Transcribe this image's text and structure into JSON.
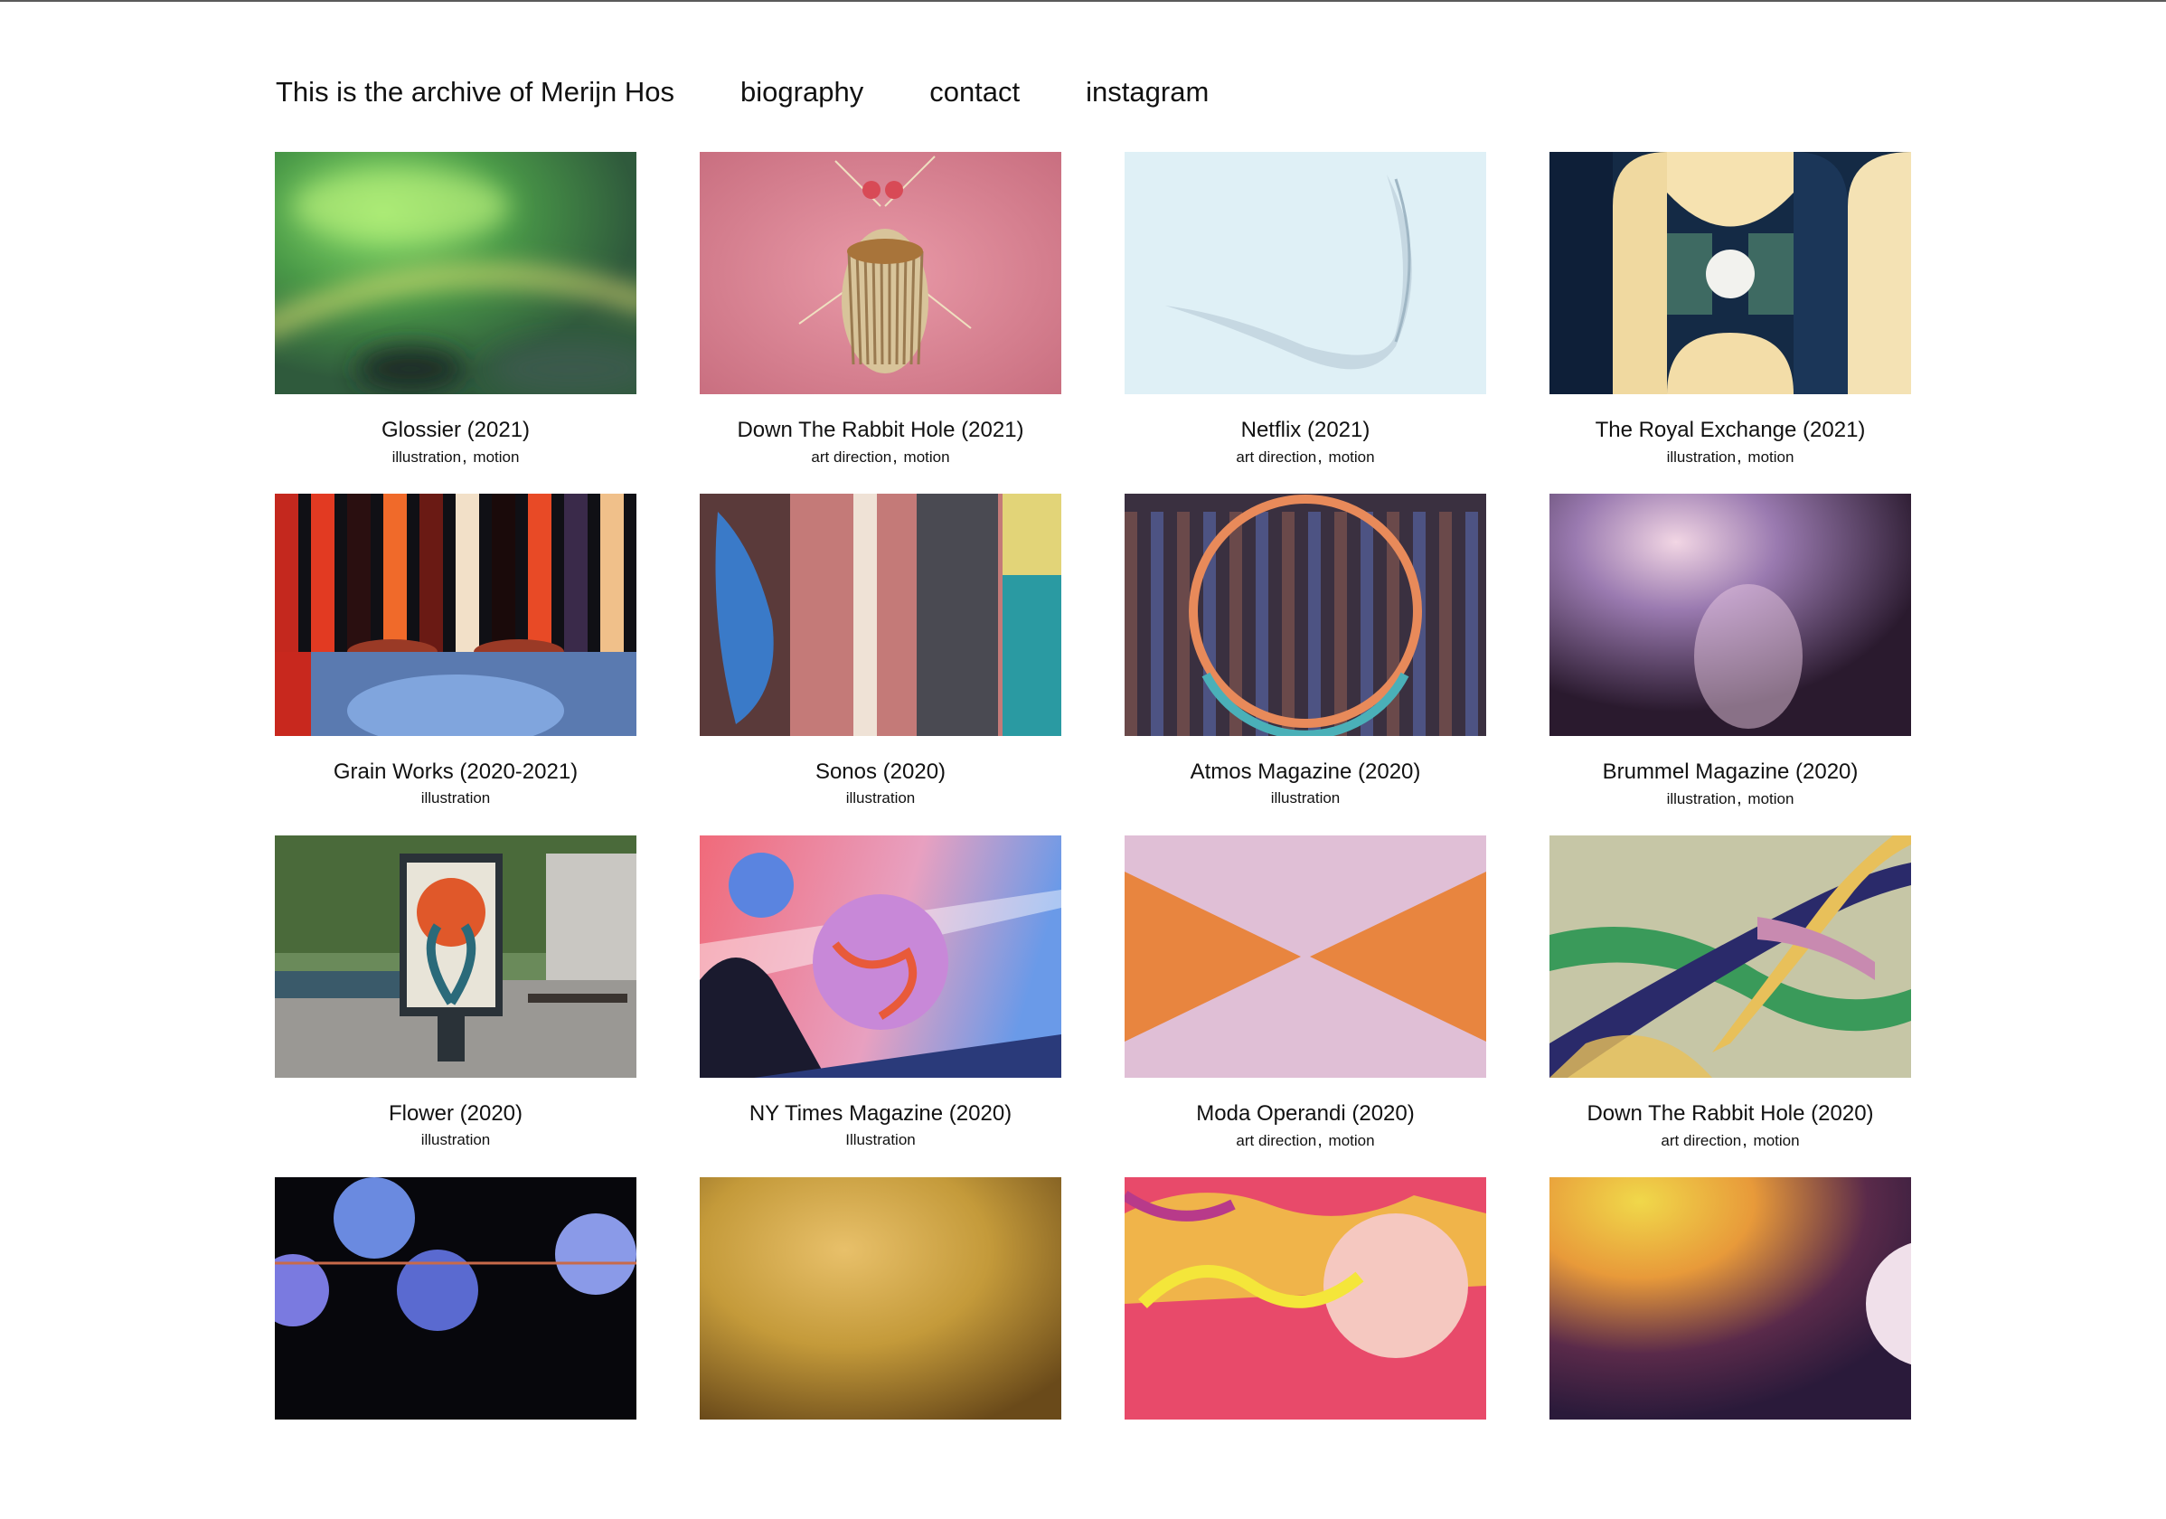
{
  "nav": {
    "site_title": "This is the archive of Merijn Hos",
    "links": [
      "biography",
      "contact",
      "instagram"
    ]
  },
  "projects": [
    {
      "title": "Glossier (2021)",
      "tags": [
        "illustration",
        "motion"
      ],
      "thumb": "glossier"
    },
    {
      "title": "Down The Rabbit Hole (2021)",
      "tags": [
        "art direction",
        "motion"
      ],
      "thumb": "rabbit2021"
    },
    {
      "title": "Netflix (2021)",
      "tags": [
        "art direction",
        "motion"
      ],
      "thumb": "netflix"
    },
    {
      "title": "The Royal Exchange (2021)",
      "tags": [
        "illustration",
        "motion"
      ],
      "thumb": "royal"
    },
    {
      "title": "Grain Works (2020-2021)",
      "tags": [
        "illustration"
      ],
      "thumb": "grain"
    },
    {
      "title": "Sonos (2020)",
      "tags": [
        "illustration"
      ],
      "thumb": "sonos"
    },
    {
      "title": "Atmos Magazine (2020)",
      "tags": [
        "illustration"
      ],
      "thumb": "atmos"
    },
    {
      "title": "Brummel Magazine (2020)",
      "tags": [
        "illustration",
        "motion"
      ],
      "thumb": "brummel"
    },
    {
      "title": "Flower (2020)",
      "tags": [
        "illustration"
      ],
      "thumb": "flower"
    },
    {
      "title": "NY Times Magazine (2020)",
      "tags": [
        "Illustration"
      ],
      "thumb": "nytimes"
    },
    {
      "title": "Moda Operandi (2020)",
      "tags": [
        "art direction",
        "motion"
      ],
      "thumb": "moda"
    },
    {
      "title": "Down The Rabbit Hole (2020)",
      "tags": [
        "art direction",
        "motion"
      ],
      "thumb": "rabbit2020"
    },
    {
      "title": "",
      "tags": [],
      "thumb": "spheres"
    },
    {
      "title": "",
      "tags": [],
      "thumb": "amber"
    },
    {
      "title": "",
      "tags": [],
      "thumb": "pinkabstract"
    },
    {
      "title": "",
      "tags": [],
      "thumb": "planetglow"
    }
  ],
  "tag_separator": ","
}
